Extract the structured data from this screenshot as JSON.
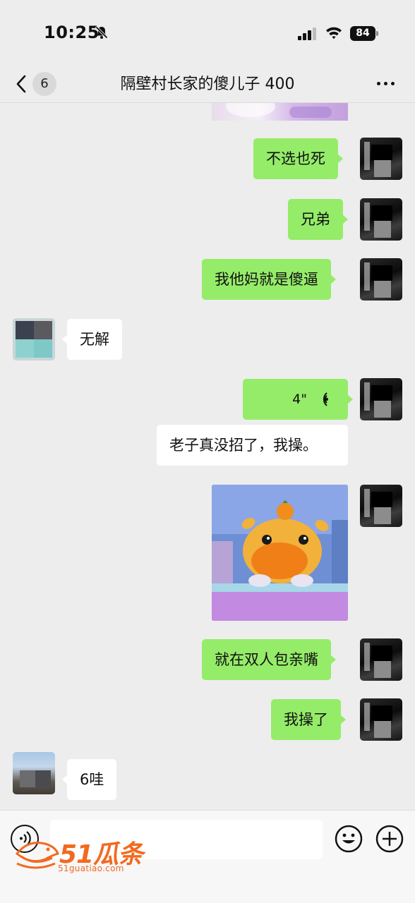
{
  "status_bar": {
    "time": "10:25",
    "battery": "84"
  },
  "header": {
    "back_badge": "6",
    "title": "隔壁村长家的傻儿子 400"
  },
  "messages": [
    {
      "side": "out",
      "type": "image",
      "desc": "partial-photo"
    },
    {
      "side": "out",
      "type": "text",
      "text": "不选也死"
    },
    {
      "side": "out",
      "type": "text",
      "text": "兄弟"
    },
    {
      "side": "out",
      "type": "text",
      "text": "我他妈就是傻逼"
    },
    {
      "side": "in",
      "type": "text",
      "text": "无解"
    },
    {
      "side": "out",
      "type": "voice",
      "duration": "4\""
    },
    {
      "side": "out",
      "type": "transcript",
      "text": "老子真没招了，我操。"
    },
    {
      "side": "out",
      "type": "image",
      "desc": "cartoon-sticker"
    },
    {
      "side": "out",
      "type": "text",
      "text": "就在双人包亲嘴"
    },
    {
      "side": "out",
      "type": "text",
      "text": "我操了"
    },
    {
      "side": "in",
      "type": "text",
      "text": "6哇"
    }
  ],
  "watermark": {
    "brand": "51瓜条",
    "url": "51guatiao.com"
  },
  "colors": {
    "outgoing_bubble": "#95ec69",
    "incoming_bubble": "#ffffff",
    "background": "#ededed",
    "watermark": "#f26a20"
  },
  "icons": [
    "mute-bell-icon",
    "signal-icon",
    "wifi-icon",
    "battery-icon",
    "back-chevron-icon",
    "more-dots-icon",
    "voice-wave-icon",
    "voice-input-icon",
    "emoji-icon",
    "plus-icon"
  ]
}
